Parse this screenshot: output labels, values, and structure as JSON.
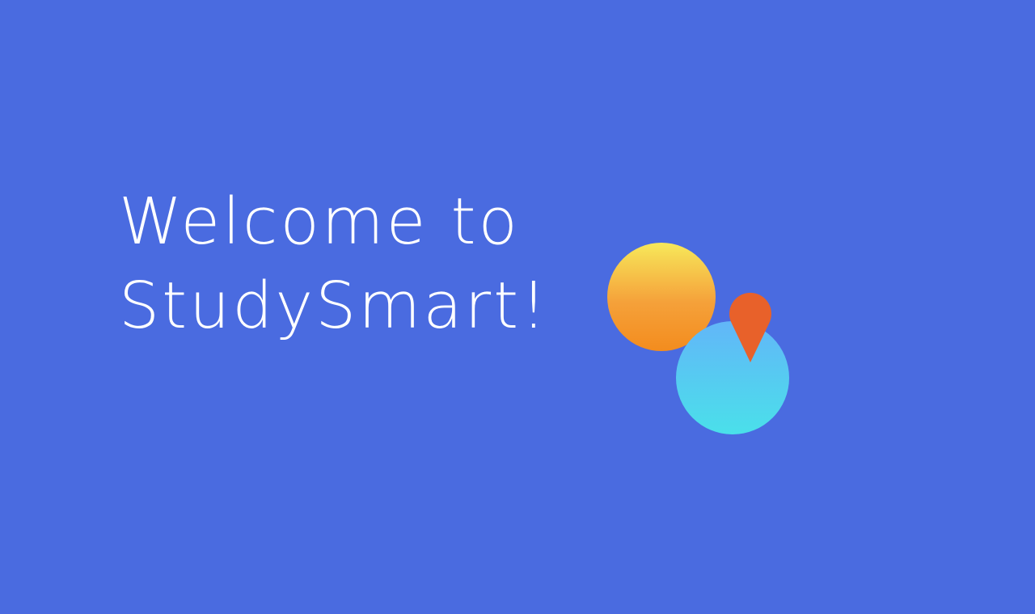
{
  "welcome": {
    "line1": "Welcome to",
    "line2": "StudySmart!"
  },
  "logo": {
    "icon": "studysmart-logo-icon",
    "sun_gradient": [
      "#f7e85a",
      "#f5a13a",
      "#f38c1e"
    ],
    "globe_gradient": [
      "#62b6f8",
      "#4ae0ea"
    ],
    "pin_color": "#e8612a"
  },
  "colors": {
    "background": "#4a6be0",
    "text": "#ffffff"
  }
}
